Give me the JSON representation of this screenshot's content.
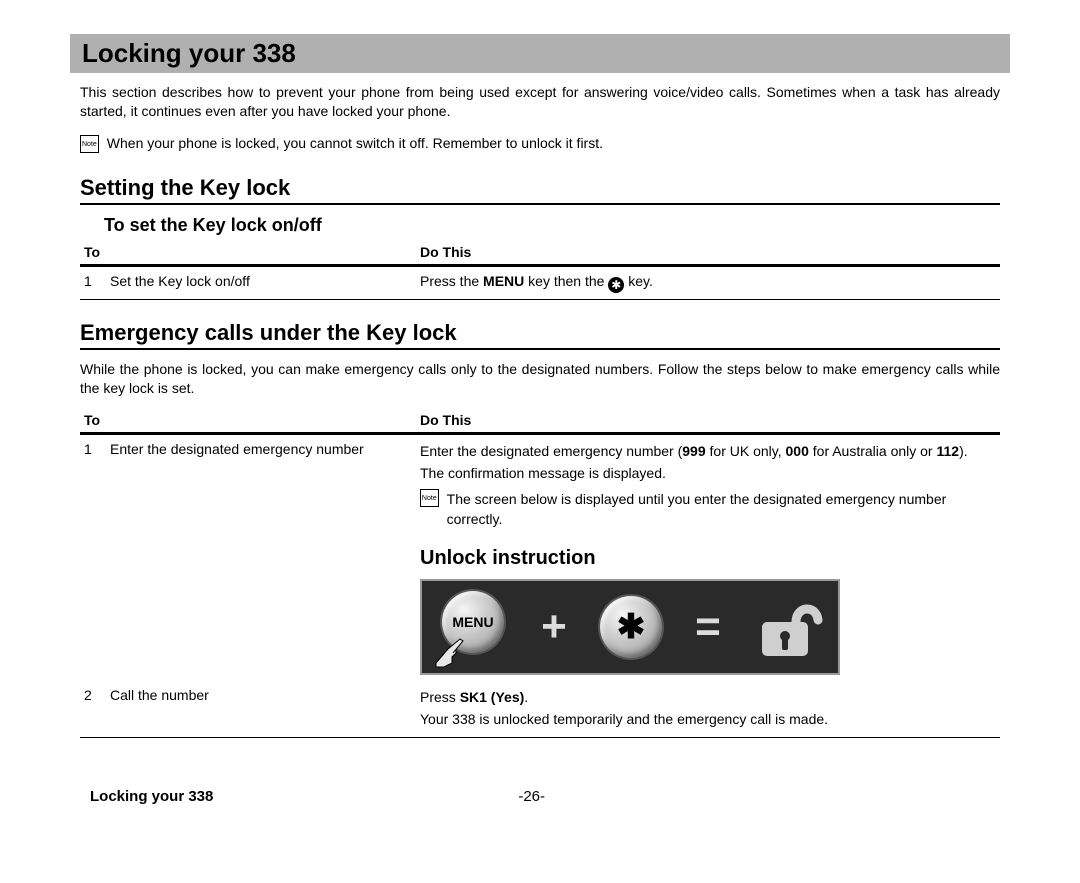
{
  "title": "Locking your 338",
  "intro": "This section describes how to prevent your phone from being used except for answering voice/video calls. Sometimes when a task has already started, it continues even after you have locked your phone.",
  "note_icon": "Note",
  "top_note": "When your phone is locked, you cannot switch it off. Remember to unlock it first.",
  "section1": {
    "heading": "Setting the Key lock",
    "sub": "To set the Key lock on/off",
    "head_to": "To",
    "head_do": "Do This",
    "row": {
      "num": "1",
      "to": "Set the Key lock on/off",
      "do_pre": "Press the ",
      "do_key": "MENU",
      "do_mid": " key then the ",
      "do_post": " key."
    }
  },
  "section2": {
    "heading": "Emergency calls under the Key lock",
    "para": "While the phone is locked, you can make emergency calls only to the designated numbers. Follow the steps below to make emergency calls while the key lock is set.",
    "head_to": "To",
    "head_do": "Do This",
    "row1": {
      "num": "1",
      "to": "Enter the designated emergency number",
      "l1a": "Enter the designated emergency number (",
      "l1b": "999",
      "l1c": " for UK only, ",
      "l1d": "000",
      "l1e": " for Australia only or ",
      "l1f": "112",
      "l1g": ").",
      "l2": "The confirmation message is displayed.",
      "note": "The screen below is displayed until you enter the designated emergency number correctly."
    },
    "unlock_caption": "Unlock instruction",
    "diagram": {
      "menu": "MENU",
      "plus": "+",
      "star": "✱",
      "eq": "="
    },
    "row2": {
      "num": "2",
      "to": "Call the number",
      "l1a": "Press ",
      "l1b": "SK1 (Yes)",
      "l1c": ".",
      "l2": "Your 338 is unlocked temporarily and the emergency call is made."
    }
  },
  "footer": {
    "left": "Locking your 338",
    "page": "-26-"
  }
}
